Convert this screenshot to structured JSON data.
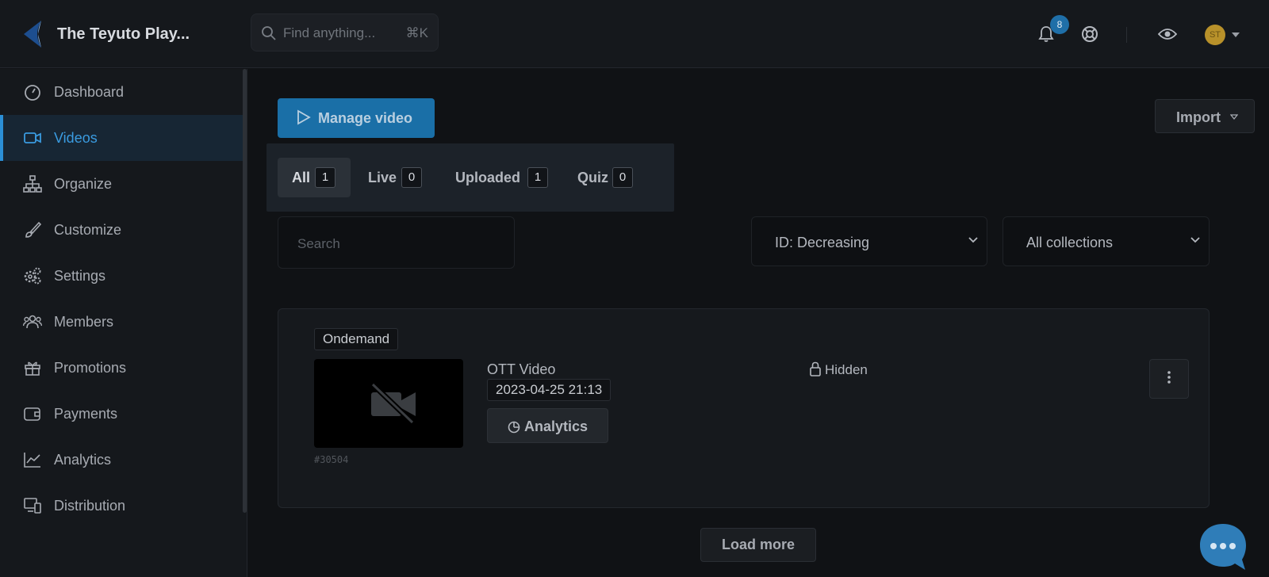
{
  "app": {
    "title": "The Teyuto Play..."
  },
  "search": {
    "placeholder": "Find anything...",
    "shortcut": "⌘K"
  },
  "header": {
    "notifications_count": "8",
    "avatar_initials": "ST",
    "icons": [
      "bell-icon",
      "help-lifebuoy-icon",
      "eye-icon",
      "caret-down-icon"
    ]
  },
  "sidebar": {
    "items": [
      {
        "label": "Dashboard",
        "icon": "gauge-icon"
      },
      {
        "label": "Videos",
        "icon": "video-camera-icon",
        "active": true
      },
      {
        "label": "Organize",
        "icon": "sitemap-icon"
      },
      {
        "label": "Customize",
        "icon": "brush-icon"
      },
      {
        "label": "Settings",
        "icon": "gears-icon"
      },
      {
        "label": "Members",
        "icon": "users-icon"
      },
      {
        "label": "Promotions",
        "icon": "gift-icon"
      },
      {
        "label": "Payments",
        "icon": "wallet-icon"
      },
      {
        "label": "Analytics",
        "icon": "line-chart-icon"
      },
      {
        "label": "Distribution",
        "icon": "devices-icon"
      }
    ]
  },
  "toolbar": {
    "manage_label": "Manage video",
    "import_label": "Import"
  },
  "tabs": [
    {
      "label": "All",
      "count": "1",
      "active": true
    },
    {
      "label": "Live",
      "count": "0"
    },
    {
      "label": "Uploaded",
      "count": "1"
    },
    {
      "label": "Quiz",
      "count": "0"
    }
  ],
  "filters": {
    "search_placeholder": "Search",
    "sort_value": "ID: Decreasing",
    "collection_value": "All collections"
  },
  "video": {
    "type_tag": "Ondemand",
    "id": "#30504",
    "title": "OTT Video",
    "date": "2023-04-25 21:13",
    "analytics_label": "Analytics",
    "visibility": "Hidden"
  },
  "load_more_label": "Load more",
  "colors": {
    "accent": "#1a6fa7",
    "active_nav": "#3a9be0",
    "background": "#101215"
  }
}
